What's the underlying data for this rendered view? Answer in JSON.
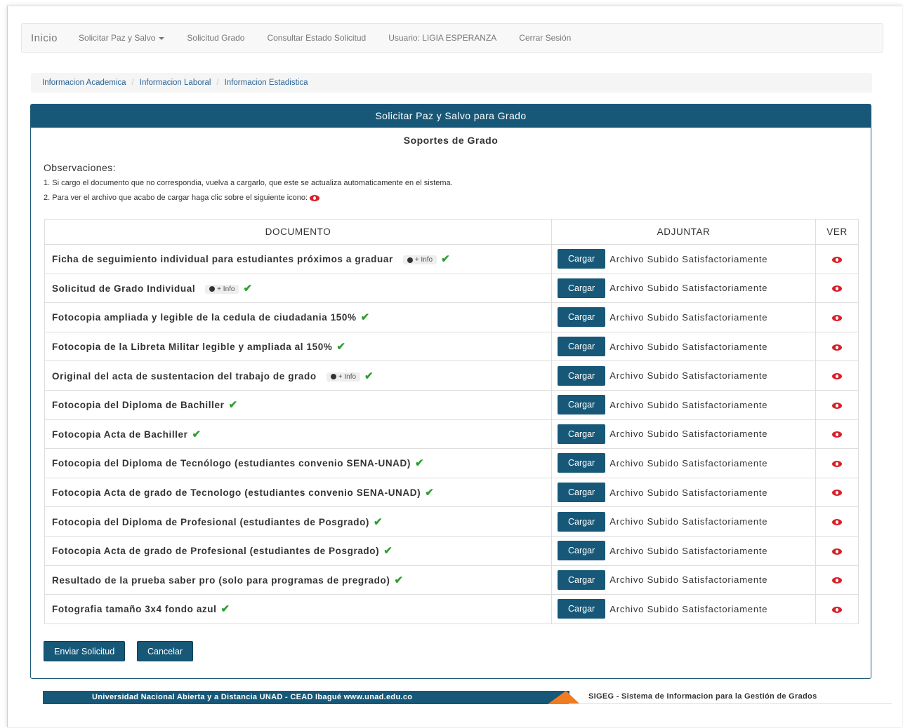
{
  "navbar": {
    "brand": "Inicio",
    "items": [
      {
        "label": "Solicitar Paz y Salvo"
      },
      {
        "label": "Solicitud Grado"
      },
      {
        "label": "Consultar Estado Solicitud"
      },
      {
        "label": "Usuario: LIGIA ESPERANZA"
      },
      {
        "label": "Cerrar Sesión"
      }
    ]
  },
  "breadcrumb": [
    "Informacion Academica",
    "Informacion Laboral",
    "Informacion Estadistica"
  ],
  "panel": {
    "heading": "Solicitar Paz y Salvo para Grado",
    "subtitle": "Soportes de Grado",
    "observations_title": "Observaciones:",
    "observations": [
      "1. Si cargo el documento que no correspondia, vuelva a cargarlo, que este se actualiza automaticamente en el sistema.",
      "2. Para ver el archivo que acabo de cargar haga clic sobre el siguiente icono:"
    ]
  },
  "table": {
    "headers": {
      "documento": "DOCUMENTO",
      "adjuntar": "ADJUNTAR",
      "ver": "VER"
    },
    "upload_label": "Cargar",
    "status_text": "Archivo Subido Satisfactoriamente",
    "info_label": "+ Info",
    "rows": [
      {
        "document": "Ficha de seguimiento individual para estudiantes próximos a graduar",
        "info": true
      },
      {
        "document": "Solicitud de Grado Individual",
        "info": true
      },
      {
        "document": "Fotocopia ampliada y legible de la cedula de ciudadania 150%",
        "info": false
      },
      {
        "document": "Fotocopia de la Libreta Militar legible y ampliada al 150%",
        "info": false
      },
      {
        "document": "Original del acta de sustentacion del trabajo de grado",
        "info": true
      },
      {
        "document": "Fotocopia del Diploma de Bachiller",
        "info": false
      },
      {
        "document": "Fotocopia Acta de Bachiller",
        "info": false
      },
      {
        "document": "Fotocopia del Diploma de Tecnólogo (estudiantes convenio SENA-UNAD)",
        "info": false
      },
      {
        "document": "Fotocopia Acta de grado de Tecnologo (estudiantes convenio SENA-UNAD)",
        "info": false
      },
      {
        "document": "Fotocopia del Diploma de Profesional (estudiantes de Posgrado)",
        "info": false
      },
      {
        "document": "Fotocopia Acta de grado de Profesional (estudiantes de Posgrado)",
        "info": false
      },
      {
        "document": "Resultado de la prueba saber pro (solo para programas de pregrado)",
        "info": false
      },
      {
        "document": "Fotografia tamaño 3x4 fondo azul",
        "info": false
      }
    ]
  },
  "actions": {
    "submit": "Enviar Solicitud",
    "cancel": "Cancelar"
  },
  "footer": {
    "left": "Universidad Nacional Abierta y a Distancia UNAD - CEAD Ibagué  www.unad.edu.co",
    "right": "SIGEG - Sistema de Informacion para la Gestión de Grados"
  },
  "colors": {
    "primary": "#175878",
    "check": "#2e9e2e",
    "eye": "#d9202a",
    "accent": "#f07c22"
  }
}
